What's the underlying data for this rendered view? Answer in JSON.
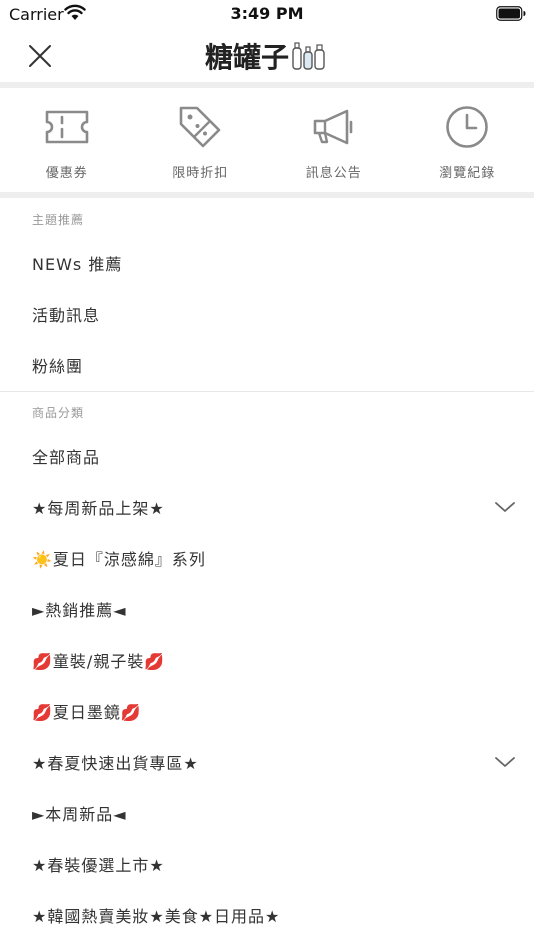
{
  "status_bar": {
    "carrier": "Carrier",
    "time": "3:49 PM"
  },
  "header": {
    "logo_text": "糖罐子"
  },
  "quick_links": [
    {
      "label": "優惠券",
      "icon": "ticket-icon"
    },
    {
      "label": "限時折扣",
      "icon": "price-tag-icon"
    },
    {
      "label": "訊息公告",
      "icon": "megaphone-icon"
    },
    {
      "label": "瀏覽紀錄",
      "icon": "clock-icon"
    }
  ],
  "sections": {
    "featured": {
      "title": "主題推薦",
      "items": [
        "NEWs 推薦",
        "活動訊息",
        "粉絲團"
      ]
    },
    "categories": {
      "title": "商品分類",
      "items": [
        "全部商品",
        "★每周新品上架★",
        "☀️夏日『涼感綿』系列",
        "►熱銷推薦◄",
        "💋童裝/親子裝💋",
        "💋夏日墨鏡💋",
        "★春夏快速出貨專區★",
        "►本周新品◄",
        "★春裝優選上市★",
        "★韓國熱賣美妝★美食★日用品★"
      ]
    }
  },
  "colors": {
    "divider": "#eeeeee",
    "icon_gray": "#8a8a8a",
    "text_primary": "#333333",
    "text_secondary": "#999999"
  }
}
